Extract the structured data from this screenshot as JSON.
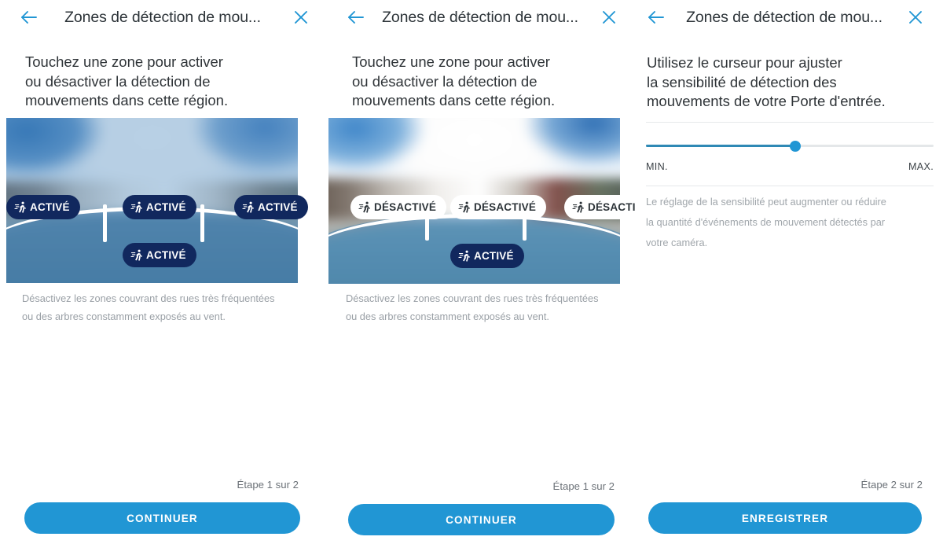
{
  "accent": "#2196d4",
  "badge_on_bg": "#11285e",
  "badge_off_bg": "#ffffff",
  "panels": [
    {
      "id": "panel-zones-activated",
      "header": {
        "back_icon": "arrow-left-icon",
        "title": "Zones de détection de mou...",
        "close_icon": "close-icon"
      },
      "intro": [
        "Touchez une zone pour activer",
        "ou désactiver la détection de",
        "mouvements dans cette région."
      ],
      "zones": [
        {
          "position": "top-left",
          "label": "ACTIVÉ",
          "state": "on"
        },
        {
          "position": "top-center",
          "label": "ACTIVÉ",
          "state": "on"
        },
        {
          "position": "top-right",
          "label": "ACTIVÉ",
          "state": "on"
        },
        {
          "position": "bottom",
          "label": "ACTIVÉ",
          "state": "on"
        }
      ],
      "caption": [
        "Désactivez les zones couvrant des rues très fréquentées",
        "ou des arbres constamment exposés au vent."
      ],
      "step": "Étape 1 sur 2",
      "cta": "CONTINUER"
    },
    {
      "id": "panel-zones-deactivated",
      "header": {
        "back_icon": "arrow-left-icon",
        "title": "Zones de détection de mou...",
        "close_icon": "close-icon"
      },
      "intro": [
        "Touchez une zone pour activer",
        "ou désactiver la détection de",
        "mouvements dans cette région."
      ],
      "zones": [
        {
          "position": "top-left",
          "label": "DÉSACTIVÉ",
          "state": "off"
        },
        {
          "position": "top-center",
          "label": "DÉSACTIVÉ",
          "state": "off"
        },
        {
          "position": "top-right",
          "label": "DÉSACTIVÉ",
          "state": "off"
        },
        {
          "position": "bottom",
          "label": "ACTIVÉ",
          "state": "on"
        }
      ],
      "caption": [
        "Désactivez les zones couvrant des rues très fréquentées",
        "ou des arbres constamment exposés au vent."
      ],
      "step": "Étape 1 sur 2",
      "cta": "CONTINUER"
    },
    {
      "id": "panel-sensitivity",
      "header": {
        "back_icon": "arrow-left-icon",
        "title": "Zones de détection de mou...",
        "close_icon": "close-icon"
      },
      "intro": [
        "Utilisez le curseur pour ajuster",
        "la sensibilité de détection des",
        "mouvements de votre Porte d'entrée."
      ],
      "slider": {
        "value_percent": 52,
        "min_label": "MIN.",
        "max_label": "MAX."
      },
      "description": [
        "Le réglage de la sensibilité peut augmenter ou réduire",
        "la quantité d'événements de mouvement détectés par",
        "votre caméra."
      ],
      "step": "Étape 2 sur 2",
      "cta": "ENREGISTRER"
    }
  ]
}
